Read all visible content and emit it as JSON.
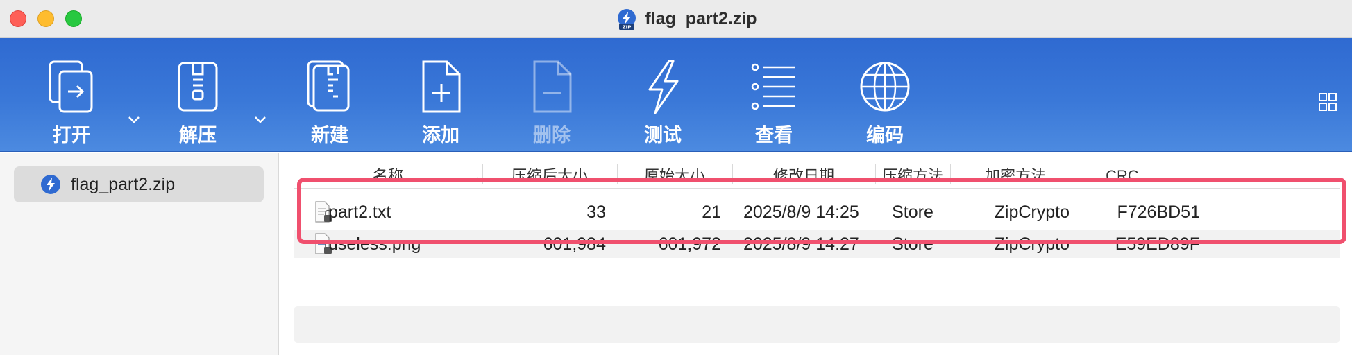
{
  "window": {
    "title": "flag_part2.zip"
  },
  "toolbar": {
    "items": [
      {
        "label": "打开",
        "icon": "open-icon"
      },
      {
        "label": "解压",
        "icon": "extract-icon"
      },
      {
        "label": "新建",
        "icon": "new-archive-icon"
      },
      {
        "label": "添加",
        "icon": "add-file-icon"
      },
      {
        "label": "删除",
        "icon": "delete-file-icon",
        "disabled": true
      },
      {
        "label": "测试",
        "icon": "lightning-icon"
      },
      {
        "label": "查看",
        "icon": "list-view-icon"
      },
      {
        "label": "编码",
        "icon": "globe-icon"
      }
    ]
  },
  "sidebar": {
    "items": [
      {
        "label": "flag_part2.zip",
        "icon": "zip-archive-icon"
      }
    ]
  },
  "columns": [
    "名称",
    "压缩后大小",
    "原始大小",
    "修改日期",
    "压缩方法",
    "加密方法",
    "CRC"
  ],
  "files": [
    {
      "name": "part2.txt",
      "compressed": "33",
      "original": "21",
      "modified": "2025/8/9 14:25",
      "method": "Store",
      "encryption": "ZipCrypto",
      "crc": "F726BD51",
      "icon": "locked-text-file-icon"
    },
    {
      "name": "useless.png",
      "compressed": "601,984",
      "original": "601,972",
      "modified": "2025/8/9 14:27",
      "method": "Store",
      "encryption": "ZipCrypto",
      "crc": "E59ED89F",
      "icon": "locked-image-file-icon"
    }
  ],
  "colors": {
    "toolbar": "#3a78d8",
    "highlight": "#f0506e",
    "zip_badge": "#2f6ad1"
  }
}
